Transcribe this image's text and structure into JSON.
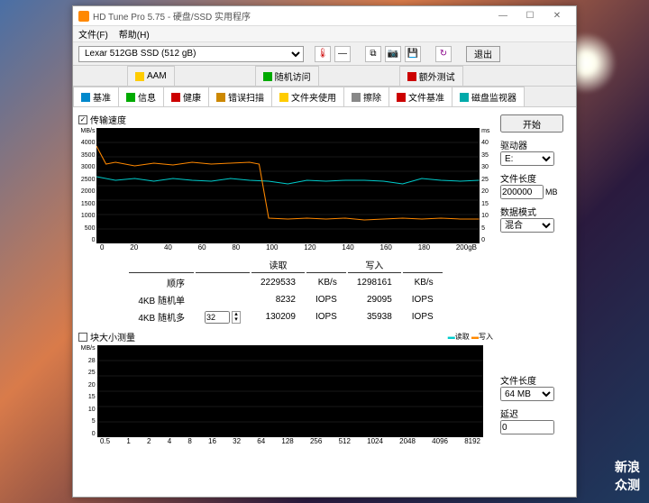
{
  "window": {
    "title": "HD Tune Pro 5.75 - 硬盘/SSD 实用程序",
    "min": "—",
    "max": "☐",
    "close": "✕"
  },
  "menu": {
    "file": "文件(F)",
    "help": "帮助(H)"
  },
  "toolbar": {
    "drive": "Lexar 512GB SSD (512 gB)",
    "exit": "退出"
  },
  "subtabs": [
    "AAM",
    "随机访问",
    "额外测试"
  ],
  "tabs": [
    "基准",
    "信息",
    "健康",
    "错误扫描",
    "文件夹使用",
    "擦除",
    "文件基准",
    "磁盘监视器"
  ],
  "active_tab": 6,
  "section1_title": "传输速度",
  "section2_title": "块大小测量",
  "legend": {
    "read": "读取",
    "write": "写入"
  },
  "y_left_unit": "MB/s",
  "y_right_unit": "ms",
  "chart_data": [
    {
      "type": "line",
      "title": "传输速度",
      "xlabel": "gB",
      "ylabel_left": "MB/s",
      "ylabel_right": "ms",
      "ylim_left": [
        0,
        4000
      ],
      "ylim_right": [
        0,
        40
      ],
      "y_ticks_left": [
        0,
        500,
        1000,
        1500,
        2000,
        2500,
        3000,
        3500,
        4000
      ],
      "y_ticks_right": [
        0,
        5,
        10,
        15,
        20,
        25,
        30,
        35,
        40
      ],
      "x_ticks": [
        0,
        20,
        40,
        60,
        80,
        100,
        120,
        140,
        160,
        180,
        "200gB"
      ],
      "series": [
        {
          "name": "读取",
          "color": "#0cc",
          "values": [
            2300,
            2200,
            2250,
            2150,
            2250,
            2200,
            2150,
            2250,
            2200,
            2180,
            2100,
            2200,
            2150,
            2200,
            2200,
            2150,
            2100,
            2250,
            2200,
            2150
          ]
        },
        {
          "name": "写入",
          "color": "#f80",
          "values": [
            3400,
            2750,
            2800,
            2700,
            2780,
            2720,
            2800,
            2750,
            2780,
            900,
            880,
            900,
            880,
            900,
            870,
            890,
            900,
            880,
            890,
            880
          ]
        }
      ]
    },
    {
      "type": "line",
      "title": "块大小测量",
      "xlabel": "KB",
      "ylabel": "MB/s",
      "ylim": [
        0,
        28
      ],
      "y_ticks": [
        0,
        5,
        10,
        15,
        20,
        25,
        28
      ],
      "x_ticks": [
        "0.5",
        1,
        2,
        4,
        8,
        16,
        32,
        64,
        128,
        256,
        512,
        1024,
        2048,
        4096,
        8192
      ],
      "series": [
        {
          "name": "读取",
          "color": "#0cc",
          "values": []
        },
        {
          "name": "写入",
          "color": "#f80",
          "values": []
        }
      ]
    }
  ],
  "results": {
    "col_read": "读取",
    "col_write": "写入",
    "rows": [
      {
        "label": "顺序",
        "read": "2229533",
        "read_u": "KB/s",
        "write": "1298161",
        "write_u": "KB/s"
      },
      {
        "label": "4KB 随机单",
        "read": "8232",
        "read_u": "IOPS",
        "write": "29095",
        "write_u": "IOPS"
      },
      {
        "label": "4KB 随机多",
        "read": "130209",
        "read_u": "IOPS",
        "write": "35938",
        "write_u": "IOPS"
      }
    ],
    "spinner_value": "32"
  },
  "side": {
    "start": "开始",
    "drive_lbl": "驱动器",
    "drive_val": "E:",
    "filelen_lbl": "文件长度",
    "filelen_val": "200000",
    "filelen_unit": "MB",
    "datamode_lbl": "数据模式",
    "datamode_val": "混合",
    "filelen2_lbl": "文件长度",
    "filelen2_val": "64 MB",
    "latency_lbl": "延迟",
    "latency_val": "0"
  },
  "watermark": {
    "line1": "新浪",
    "line2": "众测"
  }
}
